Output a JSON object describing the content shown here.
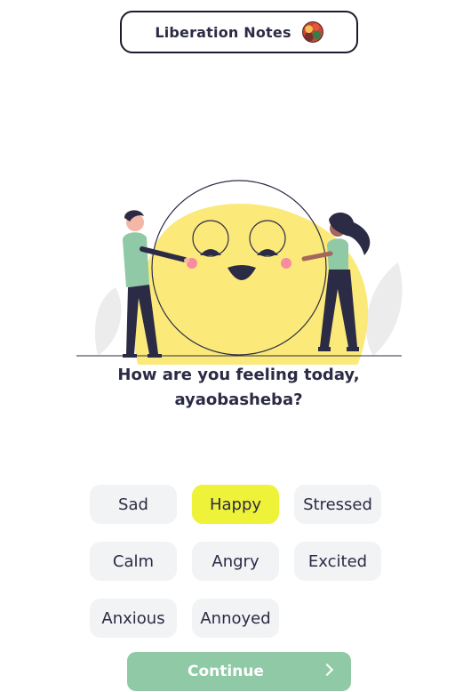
{
  "header": {
    "app_name": "Liberation Notes",
    "avatar_icon": "profile-photo-icon"
  },
  "prompt": {
    "line1": "How are you feeling today,",
    "line2": "ayaobasheba?"
  },
  "moods": [
    {
      "label": "Sad",
      "selected": false
    },
    {
      "label": "Happy",
      "selected": true
    },
    {
      "label": "Stressed",
      "selected": false
    },
    {
      "label": "Calm",
      "selected": false
    },
    {
      "label": "Angry",
      "selected": false
    },
    {
      "label": "Excited",
      "selected": false
    },
    {
      "label": "Anxious",
      "selected": false
    },
    {
      "label": "Annoyed",
      "selected": false
    }
  ],
  "continue_button": {
    "label": "Continue",
    "icon": "chevron-right-icon"
  },
  "colors": {
    "accent_selected": "#eef238",
    "chip_background": "#f2f3f5",
    "continue_background": "#8fc9a5",
    "blob_yellow": "#fbe97a",
    "text_dark": "#2b2b45"
  }
}
